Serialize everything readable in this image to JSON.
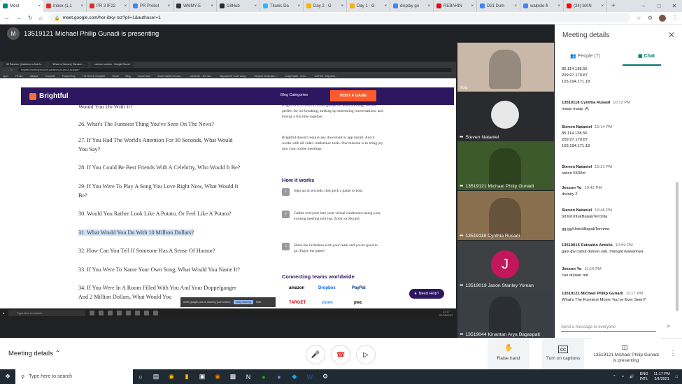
{
  "browser": {
    "tabs": [
      {
        "label": "Meet",
        "color": "#00897b",
        "active": true
      },
      {
        "label": "Inbox (1,1",
        "color": "#d93025"
      },
      {
        "label": "PR 3 IF22",
        "color": "#d93025"
      },
      {
        "label": "PR Probst",
        "color": "#4285f4"
      },
      {
        "label": "WMMY-E",
        "color": "#333333"
      },
      {
        "label": "GitHub",
        "color": "#24292e"
      },
      {
        "label": "Titanic Da",
        "color": "#20beff"
      },
      {
        "label": "Day 2 - G",
        "color": "#f4b400"
      },
      {
        "label": "Day 1 - G",
        "color": "#f4b400"
      },
      {
        "label": "display go",
        "color": "#4285f4"
      },
      {
        "label": "REBAHIN",
        "color": "#e50914"
      },
      {
        "label": "D21 Dum",
        "color": "#4285f4"
      },
      {
        "label": "walpole-fi",
        "color": "#4285f4"
      },
      {
        "label": "(34) MAN",
        "color": "#ff0000"
      }
    ],
    "new_tab": "+",
    "url": "meet.google.com/hor-ibky-rxz?pli=1&authuser=1"
  },
  "meet": {
    "presenter_text": "13519121 Michael Philip Gunadi is presenting",
    "shared_screen": {
      "tabs": [
        "89 Random Questions to Ask Ar...",
        "Wheel of Names | Random ...",
        "random number - Google Search"
      ],
      "url": "brightful.me/blog/random-questions-to-ask-a-stranger/",
      "bookmarks": [
        "Apps",
        "FE-BC",
        "Alibaba",
        "Translate",
        "Product Key",
        "The Simi 3 Complete",
        "Gmail",
        "Blog",
        "course links",
        "Stock market forecas...",
        "LeetCode - The Wo...",
        "Skyscanner Code Lang...",
        "Session Generator f...",
        "Image Math - Chro...",
        "LWTOR - Reposito..."
      ],
      "brand": "Brightful",
      "nav_categories": "Blog Categories",
      "nav_host": "HOST A GAME",
      "questions": [
        "Would You Do With It?",
        "26. What's The Funniest Thing You've Seen On The News?",
        "27. If You Had The World's Attention For 30 Seconds, What Would",
        "You Say?",
        "28. If You Could Be Best Friends With A Celebrity, Who Would It Be?",
        "29. If You Were To Play A Song You Love Right Now, What Would It",
        "Be?",
        "30. Would You Rather Look Like A Potato, Or Feel Like A Potato?",
        "31. What Would You Do With 10 Million Dollars?",
        "32. How Can You Tell If Someone Has A Sense Of Humor?",
        "33. If You Were To Name Your Own Song, What Would You Name It?",
        "34. If You Were In A Room Filled With You And Your Doppelganger",
        "And 2 Million Dollars, What Would You"
      ],
      "sidebar_p1": "Brightful is a suite of online games for team building. We are perfect for ice breaking, striking up interesting conversations, and having a fun time together.",
      "sidebar_p2": "Brightful doesn't require any download or app install. And it works with all video conference tools. Our mission is to bring joy into your online meetings.",
      "how_it_works": "How it works",
      "steps": [
        {
          "n": "1",
          "text": "Sign up in seconds, then pick a game to host."
        },
        {
          "n": "2",
          "text": "Gather everyone into your virtual conference using your existing meeting tool (eg. Zoom or Skype)."
        },
        {
          "n": "3",
          "text": "Share the invitation with your team and you're good to go. Enjoy the game!"
        }
      ],
      "connecting": "Connecting teams worldwide",
      "logos": [
        "amazon",
        "Dropbox",
        "PayPal",
        "TARGET",
        "zoom",
        "pwc"
      ],
      "need_help": "Need Help?",
      "share_notice": "meet.google.com is sharing your screen.",
      "stop_sharing": "Stop sharing",
      "hide": "Hide",
      "taskbar_search": "Type here to search",
      "taskbar_time": "23:17",
      "taskbar_date": "01/03/2021"
    },
    "participants": [
      {
        "name": "You",
        "color": "#c9b8a8"
      },
      {
        "name": "Steven Nataniel",
        "color": "#2a2b2e"
      },
      {
        "name": "13519121 Michael Philip Gunadi",
        "color": "#3d5a2a"
      },
      {
        "name": "13519118 Cynthia Rusadi",
        "color": "#8a6f4f"
      },
      {
        "name": "13519019 Jason Stanley Yoman",
        "avatar_letter": "J",
        "color": "#c2185b"
      },
      {
        "name": "13519044 Kinantan Arya Bagaspati",
        "color": "#3a3f46"
      }
    ]
  },
  "panel": {
    "title": "Meeting details",
    "tab_people": "People (7)",
    "tab_chat": "Chat",
    "messages": [
      {
        "who": "",
        "time": "",
        "text": "85.114.138.56\n209.97.170.87\n103.194.171.18"
      },
      {
        "who": "13519118 Cynthia Rusadi",
        "time": "10:12 PM",
        "text": "maap maap :A;"
      },
      {
        "who": "Steven Nataniel",
        "time": "10:14 PM",
        "text": "85.114.138.56\n209.97.170.87\n103.194.171.18"
      },
      {
        "who": "Steven Nataniel",
        "time": "10:31 PM",
        "text": "raden 5500xt"
      },
      {
        "who": "Jesson Yo",
        "time": "10:42 PM",
        "text": "divinity 2"
      },
      {
        "who": "Steven Nataniel",
        "time": "10:46 PM",
        "text": "bit.ly/UntukBapakTercinta\n\ngg.gg/UntukBapakTercinta"
      },
      {
        "who": "13519015 Reinaldo Antolis",
        "time": "10:59 PM",
        "text": "gais gw cabut duluan yak, mangat wawannya"
      },
      {
        "who": "Jesson Yo",
        "time": "11:16 PM",
        "text": "cao duluan ted"
      },
      {
        "who": "13519121 Michael Philip Gunadi",
        "time": "11:17 PM",
        "text": "What's The Funniest Movie You've Ever Seen?"
      }
    ],
    "send_placeholder": "Send a message to everyone"
  },
  "bottom": {
    "meeting_details": "Meeting details",
    "raise_hand": "Raise hand",
    "captions": "Turn on captions",
    "presenting": "13519121 Michael Philip Gunadi is presenting"
  },
  "taskbar": {
    "search_placeholder": "Type here to search",
    "lang1": "ENG",
    "lang2": "INTL",
    "time": "11:17 PM",
    "date": "3/1/2021"
  }
}
